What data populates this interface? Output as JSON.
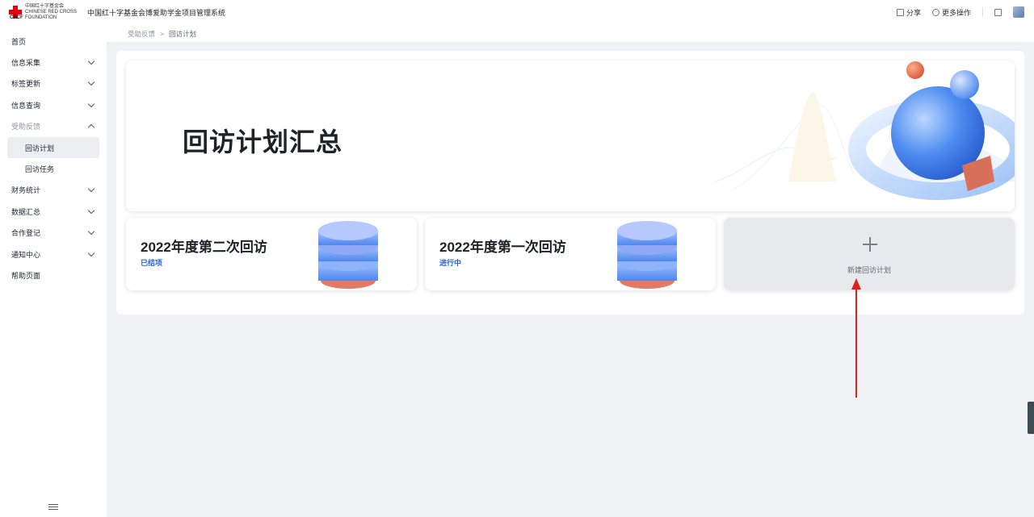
{
  "brand": {
    "logo_cn": "中国红十字基金会",
    "logo_en1": "CHINESE RED CROSS",
    "logo_en2": "FOUNDATION",
    "logo_abbr": "CRCF",
    "system_title": "中国红十字基金会博爱助学金项目管理系统",
    "accent": "#2a65d8",
    "logo_red": "#e60012"
  },
  "top_actions": {
    "share": "分享",
    "more": "更多操作"
  },
  "sidebar": {
    "items": [
      {
        "label": "首页",
        "chevron": false
      },
      {
        "label": "信息采集",
        "chevron": "down"
      },
      {
        "label": "标签更新",
        "chevron": "down"
      },
      {
        "label": "信息查询",
        "chevron": "down"
      },
      {
        "label": "受助反馈",
        "chevron": "up",
        "expanded": true
      },
      {
        "label": "回访计划",
        "sub": true,
        "active": true
      },
      {
        "label": "回访任务",
        "sub": true
      },
      {
        "label": "财务统计",
        "chevron": "down"
      },
      {
        "label": "数据汇总",
        "chevron": "down"
      },
      {
        "label": "合作登记",
        "chevron": "down"
      },
      {
        "label": "通知中心",
        "chevron": "down"
      },
      {
        "label": "帮助页面",
        "chevron": false
      }
    ]
  },
  "breadcrumb": {
    "parent": "受助反馈",
    "separator": ">",
    "current": "回访计划"
  },
  "hero": {
    "title": "回访计划汇总"
  },
  "cards": [
    {
      "title": "2022年度第二次回访",
      "status": "已结项"
    },
    {
      "title": "2022年度第一次回访",
      "status": "进行中"
    }
  ],
  "new_card": {
    "label": "新建回访计划"
  }
}
